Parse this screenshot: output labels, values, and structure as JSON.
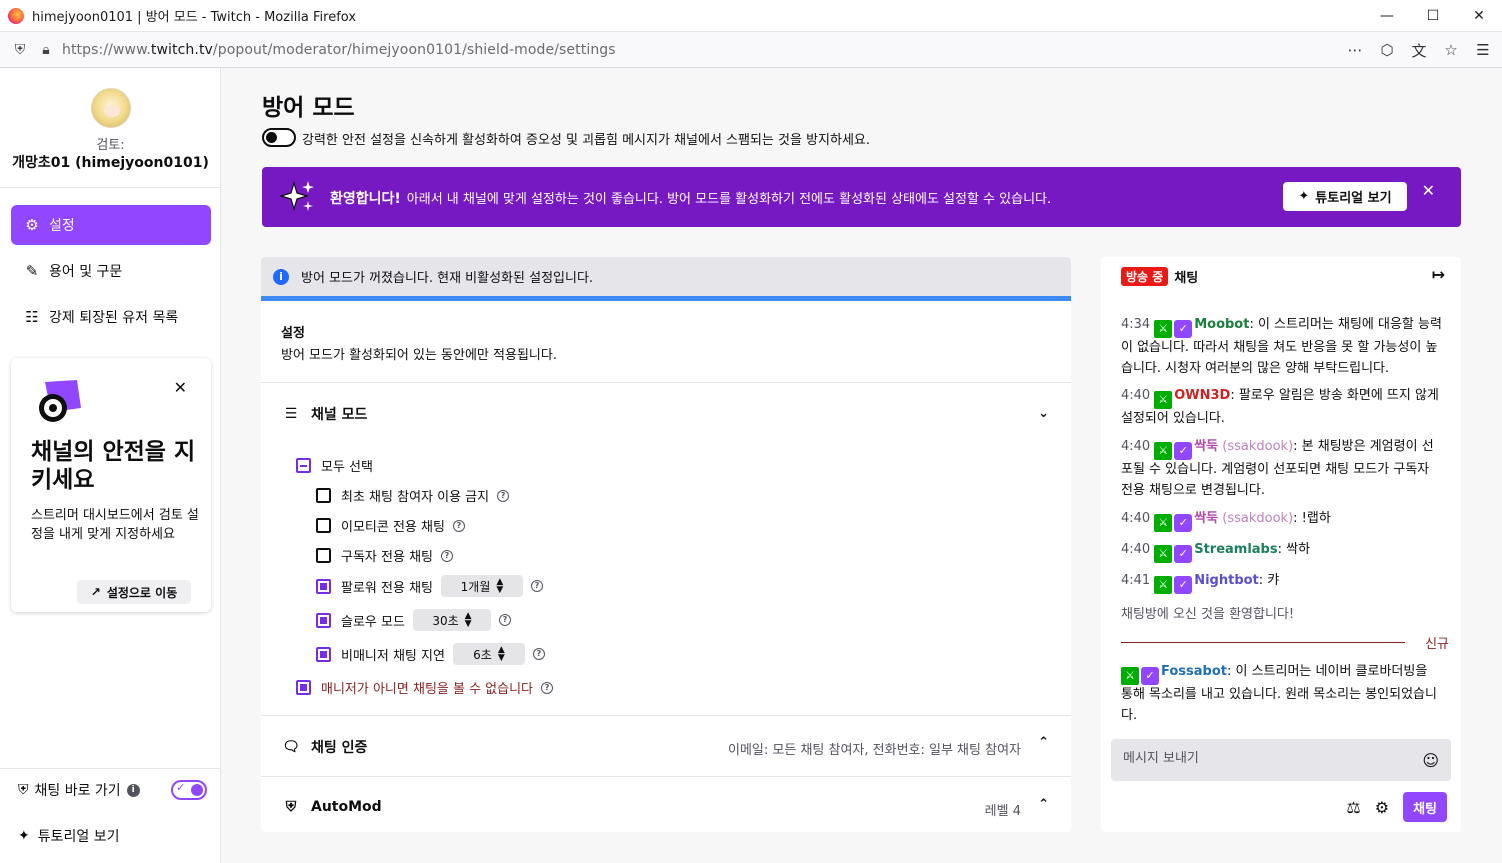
{
  "browser": {
    "title": "himejyoon0101 | 방어 모드 - Twitch - Mozilla Firefox",
    "url_prefix": "https://www.",
    "url_domain": "twitch.tv",
    "url_path": "/popout/moderator/himejyoon0101/shield-mode/settings"
  },
  "sidebar": {
    "review_label": "검토:",
    "channel_name": "개망초01 (himejyoon0101)",
    "items": [
      {
        "label": "설정",
        "icon": "gear-icon",
        "active": true
      },
      {
        "label": "용어 및 구문",
        "icon": "pencil-icon",
        "active": false
      },
      {
        "label": "강제 퇴장된 유저 목록",
        "icon": "users-icon",
        "active": false
      }
    ],
    "promo": {
      "title": "채널의 안전을 지키세요",
      "desc": "스트리머 대시보드에서 검토 설정을 내게 맞게 지정하세요",
      "button": "설정으로 이동"
    },
    "chat_shortcut": "채팅 바로 가기",
    "tutorial": "튜토리얼 보기"
  },
  "main": {
    "title": "방어 모드",
    "toggle_desc": "강력한 안전 설정을 신속하게 활성화하여 증오성 및 괴롭힘 메시지가 채널에서 스팸되는 것을 방지하세요.",
    "banner": {
      "heading": "환영합니다!",
      "text": "아래서 내 채널에 맞게 설정하는 것이 좋습니다. 방어 모드를 활성화하기 전에도 활성화된 상태에도 설정할 수 있습니다.",
      "button": "튜토리얼 보기"
    },
    "alert": "방어 모드가 꺼졌습니다. 현재 비활성화된 설정입니다.",
    "settings_title": "설정",
    "settings_desc": "방어 모드가 활성화되어 있는 동안에만 적용됩니다.",
    "channel_modes": {
      "title": "채널 모드",
      "select_all": "모두 선택",
      "options": [
        {
          "label": "최초 채팅 참여자 이용 금지",
          "checked": false
        },
        {
          "label": "이모티콘 전용 채팅",
          "checked": false
        },
        {
          "label": "구독자 전용 채팅",
          "checked": false
        },
        {
          "label": "팔로워 전용 채팅",
          "checked": true,
          "select": "1개월"
        },
        {
          "label": "슬로우 모드",
          "checked": true,
          "select": "30초"
        },
        {
          "label": "비매니저 채팅 지연",
          "checked": true,
          "select": "6초"
        }
      ],
      "non_manager": "매니저가 아니면 채팅을 볼 수 없습니다"
    },
    "chat_verification": {
      "title": "채팅 인증",
      "summary": "이메일: 모든 채팅 참여자, 전화번호: 일부 채팅 참여자"
    },
    "automod": {
      "title": "AutoMod",
      "summary": "레벨 4"
    }
  },
  "chat": {
    "live_badge": "방송 중",
    "title": "채팅",
    "messages": [
      {
        "time": "4:34",
        "user": "Moobot",
        "user_color": "#1a7f3a",
        "verified": true,
        "text": "이 스트리머는 채팅에 대응할 능력이 없습니다. 따라서 채팅을 쳐도 반응을 못 할 가능성이 높습니다. 시청자 여러분의 많은 양해 부탁드립니다."
      },
      {
        "time": "4:40",
        "user": "OWN3D",
        "user_color": "#cc2222",
        "verified": false,
        "text": "팔로우 알림은 방송 화면에 뜨지 않게 설정되어 있습니다."
      },
      {
        "time": "4:40",
        "user": "싹둑",
        "user_extra": "(ssakdook)",
        "user_color": "#b04ba8",
        "verified": true,
        "text": "본 채팅방은 계엄령이 선포될 수 있습니다. 계엄령이 선포되면 채팅 모드가 구독자 전용 채팅으로 변경됩니다."
      },
      {
        "time": "4:40",
        "user": "싹둑",
        "user_extra": "(ssakdook)",
        "user_color": "#b04ba8",
        "verified": true,
        "text": "!랩하"
      },
      {
        "time": "4:40",
        "user": "Streamlabs",
        "user_color": "#1a7f5a",
        "verified": true,
        "text": "싹하"
      },
      {
        "time": "4:41",
        "user": "Nightbot",
        "user_color": "#5a4fcf",
        "verified": true,
        "text": "캬"
      }
    ],
    "welcome": "채팅방에 오신 것을 환영합니다!",
    "new_label": "신규",
    "new_message": {
      "user": "Fossabot",
      "user_color": "#1f6fb5",
      "text": "이 스트리머는 네이버 클로바더빙을 통해 목소리를 내고 있습니다. 원래 목소리는 봉인되었습니다."
    },
    "input_placeholder": "메시지 보내기",
    "send": "채팅"
  }
}
